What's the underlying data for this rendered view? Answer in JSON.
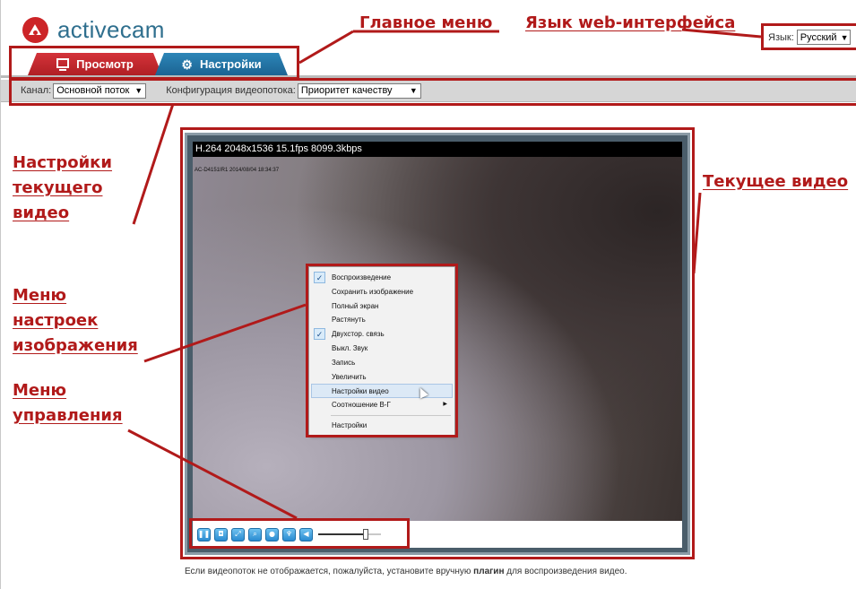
{
  "brand": {
    "logo_text": "activecam",
    "accent": "#cc2427",
    "link_blue": "#2f6f8e"
  },
  "tabs": [
    {
      "label": "Просмотр",
      "icon": "monitor-icon",
      "active": true,
      "color": "#c7262c"
    },
    {
      "label": "Настройки",
      "icon": "gear-icon",
      "active": false,
      "color": "#1f72a8"
    }
  ],
  "language": {
    "label": "Язык:",
    "selected": "Русский"
  },
  "channel_bar": {
    "channel_label": "Канал:",
    "channel_value": "Основной поток",
    "config_label": "Конфигурация видеопотока:",
    "config_value": "Приоритет качеству"
  },
  "video": {
    "header": "H.264 2048x1536 15.1fps 8099.3kbps",
    "osd": "AC-D4151IR1 2014/08/04 18:34:37"
  },
  "controls": {
    "buttons": [
      "pause-icon",
      "snapshot-icon",
      "fullscreen-icon",
      "zoom-icon",
      "record-icon",
      "talk-icon",
      "volume-icon"
    ],
    "volume_level": 0.75
  },
  "context_menu": {
    "items": [
      {
        "label": "Воспроизведение",
        "checked": true,
        "highlighted": false,
        "submenu": false
      },
      {
        "label": "Сохранить изображение",
        "checked": false,
        "highlighted": false,
        "submenu": false
      },
      {
        "label": "Полный экран",
        "checked": false,
        "highlighted": false,
        "submenu": false
      },
      {
        "label": "Растянуть",
        "checked": false,
        "highlighted": false,
        "submenu": false
      },
      {
        "label": "Двухстор. связь",
        "checked": true,
        "highlighted": false,
        "submenu": false
      },
      {
        "label": "Выкл. Звук",
        "checked": false,
        "highlighted": false,
        "submenu": false
      },
      {
        "label": "Запись",
        "checked": false,
        "highlighted": false,
        "submenu": false
      },
      {
        "label": "Увеличить",
        "checked": false,
        "highlighted": false,
        "submenu": false
      },
      {
        "label": "Настройки видео",
        "checked": false,
        "highlighted": true,
        "submenu": false
      },
      {
        "label": "Соотношение В-Г",
        "checked": false,
        "highlighted": false,
        "submenu": true
      }
    ],
    "footer_item": "Настройки"
  },
  "footnote": {
    "before": "Если видеопоток не отображается, пожалуйста, установите вручную ",
    "bold": "плагин",
    "after": " для воспроизведения видео."
  },
  "annotations": {
    "color": "#b11a1a",
    "main_menu": "Главное меню",
    "web_language": "Язык web-интерфейса",
    "current_video_settings": [
      "Настройки",
      "текущего",
      "видео"
    ],
    "current_video": "Текущее видео",
    "image_settings_menu": [
      "Меню",
      "настроек",
      "изображения"
    ],
    "control_menu": [
      "Меню",
      "управления"
    ]
  }
}
